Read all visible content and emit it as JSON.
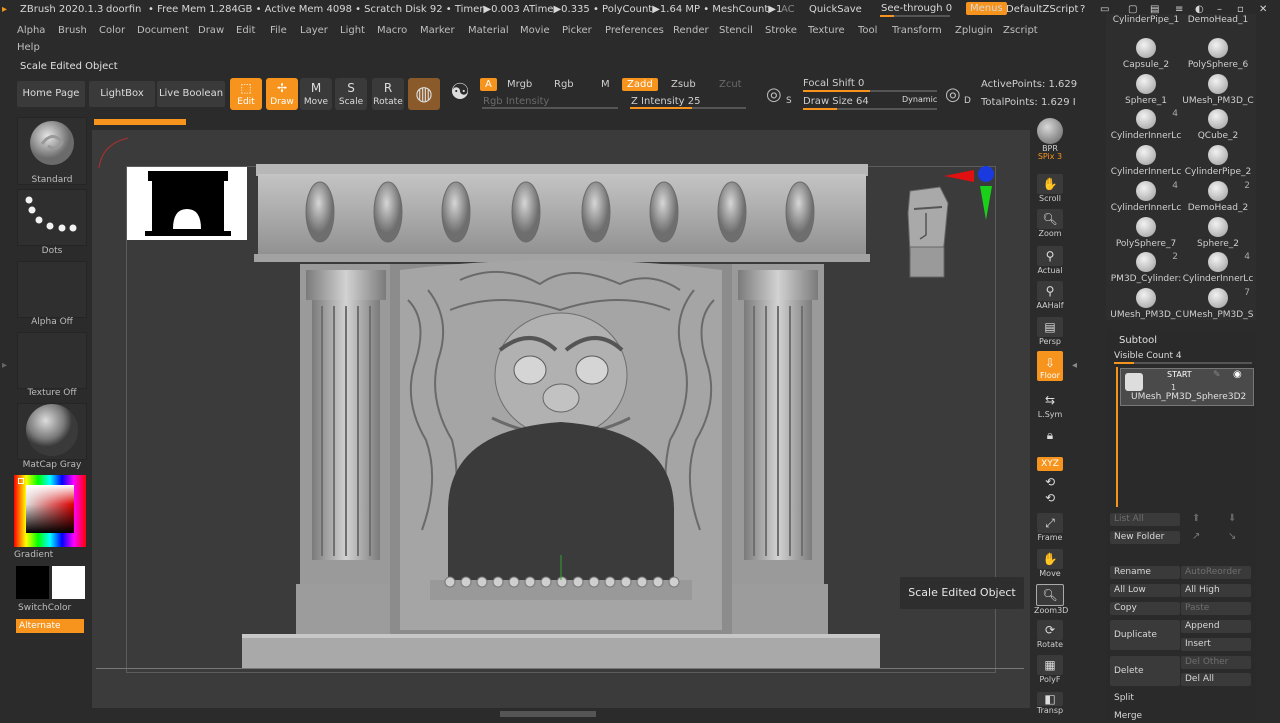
{
  "titlebar": {
    "app": "ZBrush 2020.1.3",
    "doc": "doorfin",
    "stats": "• Free Mem 1.284GB • Active Mem 4098 • Scratch Disk 92 • Timer▶0.003 ATime▶0.335 • PolyCount▶1.64 MP • MeshCount▶1",
    "ac": "AC",
    "quicksave": "QuickSave",
    "see_through": "See-through  0",
    "menus": "Menus",
    "default_zscript": "DefaultZScript"
  },
  "menu": {
    "items": [
      "Alpha",
      "Brush",
      "Color",
      "Document",
      "Draw",
      "Edit",
      "File",
      "Layer",
      "Light",
      "Macro",
      "Marker",
      "Material",
      "Movie",
      "Picker",
      "Preferences",
      "Render",
      "Stencil",
      "Stroke",
      "Texture",
      "Tool",
      "Transform",
      "Zplugin",
      "Zscript"
    ],
    "help": "Help"
  },
  "shelf": {
    "status": "Scale Edited Object",
    "home_page": "Home Page",
    "lightbox": "LightBox",
    "live_boolean": "Live Boolean",
    "edit": "Edit",
    "draw": "Draw",
    "move": "Move",
    "scale": "Scale",
    "rotate": "Rotate",
    "a": "A",
    "mrgb": "Mrgb",
    "rgb": "Rgb",
    "m": "M",
    "rgb_intensity": "Rgb Intensity",
    "zadd": "Zadd",
    "zsub": "Zsub",
    "zcut": "Zcut",
    "z_intensity": "Z Intensity 25",
    "focal_shift": "Focal Shift 0",
    "draw_size": "Draw Size 64",
    "dynamic": "Dynamic",
    "active_points": "ActivePoints: 1.629",
    "total_points": "TotalPoints: 1.629 I"
  },
  "left_panel": {
    "standard": "Standard",
    "dots": "Dots",
    "alpha_off": "Alpha Off",
    "texture_off": "Texture Off",
    "matcap": "MatCap Gray",
    "gradient": "Gradient",
    "switch_color": "SwitchColor",
    "alternate": "Alternate"
  },
  "right_toolbar": {
    "bpr": "BPR",
    "spix": "SPix 3",
    "scroll": "Scroll",
    "zoom": "Zoom",
    "actual": "Actual",
    "aahalf": "AAHalf",
    "persp": "Persp",
    "floor": "Floor",
    "lsym": "L.Sym",
    "xyz": "XYZ",
    "frame": "Frame",
    "move": "Move",
    "zoom3d": "Zoom3D",
    "rotate": "Rotate",
    "polyf": "PolyF",
    "transp": "Transp"
  },
  "tool_palette": {
    "items": [
      {
        "name": "CylinderPipe_1",
        "count": ""
      },
      {
        "name": "DemoHead_1",
        "count": ""
      },
      {
        "name": "Capsule_2",
        "count": ""
      },
      {
        "name": "PolySphere_6",
        "count": ""
      },
      {
        "name": "Sphere_1",
        "count": ""
      },
      {
        "name": "UMesh_PM3D_C",
        "count": ""
      },
      {
        "name": "CylinderInnerLc",
        "count": "4"
      },
      {
        "name": "QCube_2",
        "count": ""
      },
      {
        "name": "CylinderInnerLc",
        "count": ""
      },
      {
        "name": "CylinderPipe_2",
        "count": ""
      },
      {
        "name": "CylinderInnerLc",
        "count": "4"
      },
      {
        "name": "DemoHead_2",
        "count": "2"
      },
      {
        "name": "PolySphere_7",
        "count": ""
      },
      {
        "name": "Sphere_2",
        "count": ""
      },
      {
        "name": "PM3D_Cylinder:",
        "count": "2"
      },
      {
        "name": "CylinderInnerLc",
        "count": "4"
      },
      {
        "name": "UMesh_PM3D_C",
        "count": ""
      },
      {
        "name": "UMesh_PM3D_S",
        "count": "7"
      }
    ]
  },
  "subtool": {
    "title": "Subtool",
    "visible_count": "Visible Count 4",
    "start": "START",
    "index": "1",
    "item_name": "UMesh_PM3D_Sphere3D2",
    "list_all": "List All",
    "new_folder": "New Folder",
    "rename": "Rename",
    "auto_reorder": "AutoReorder",
    "all_low": "All Low",
    "all_high": "All High",
    "copy": "Copy",
    "paste": "Paste",
    "duplicate": "Duplicate",
    "append": "Append",
    "insert": "Insert",
    "delete": "Delete",
    "del_other": "Del Other",
    "del_all": "Del All",
    "split": "Split",
    "merge": "Merge"
  },
  "tooltip": "Scale Edited Object",
  "colors": {
    "accent": "#f7941d",
    "bg": "#2b2b2b",
    "canvas": "#3b3b3b"
  }
}
